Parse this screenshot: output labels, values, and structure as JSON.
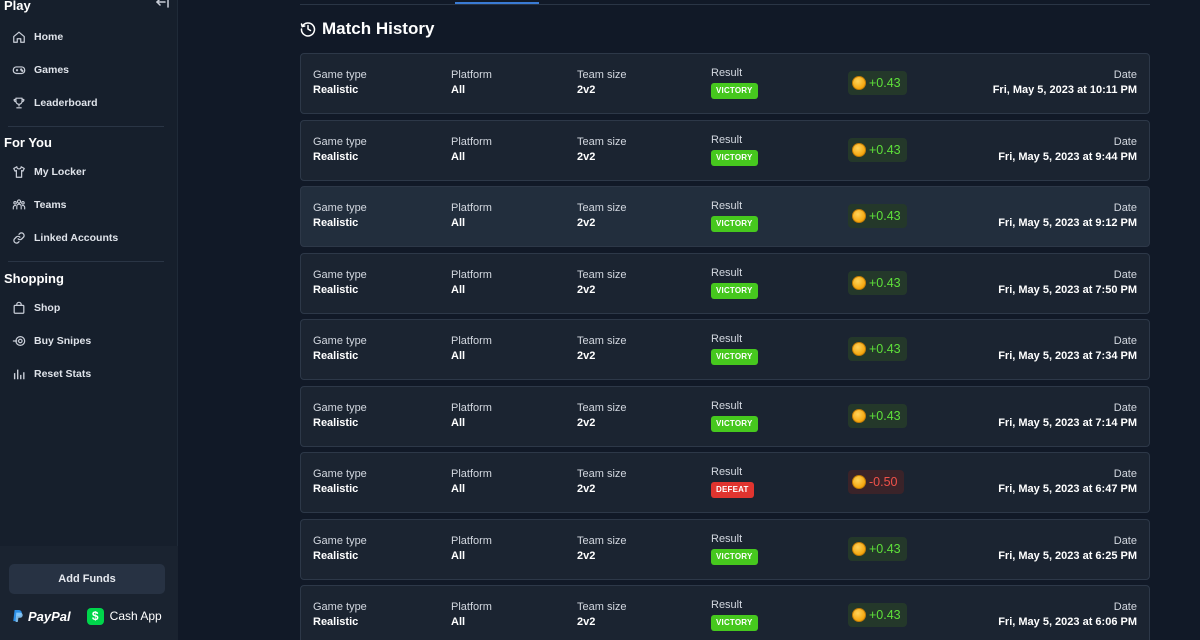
{
  "sidebar": {
    "sections": {
      "play": "Play",
      "for_you": "For You",
      "shopping": "Shopping"
    },
    "play_items": [
      {
        "label": "Home",
        "icon": "home-icon"
      },
      {
        "label": "Games",
        "icon": "gamepad-icon"
      },
      {
        "label": "Leaderboard",
        "icon": "trophy-icon"
      }
    ],
    "for_you_items": [
      {
        "label": "My Locker",
        "icon": "shirt-icon"
      },
      {
        "label": "Teams",
        "icon": "people-icon"
      },
      {
        "label": "Linked Accounts",
        "icon": "link-icon"
      }
    ],
    "shopping_items": [
      {
        "label": "Shop",
        "icon": "bag-icon"
      },
      {
        "label": "Buy Snipes",
        "icon": "target-icon"
      },
      {
        "label": "Reset Stats",
        "icon": "bar-chart-icon"
      }
    ],
    "add_funds_label": "Add Funds",
    "paypal_label": "PayPal",
    "cashapp_label": "Cash App",
    "cashapp_symbol": "$"
  },
  "main": {
    "title": "Match History",
    "labels": {
      "game_type": "Game type",
      "platform": "Platform",
      "team_size": "Team size",
      "result": "Result",
      "date": "Date"
    },
    "matches": [
      {
        "game_type": "Realistic",
        "platform": "All",
        "team_size": "2v2",
        "result": "VICTORY",
        "amount": "+0.43",
        "date": "Fri, May 5, 2023 at 10:11 PM"
      },
      {
        "game_type": "Realistic",
        "platform": "All",
        "team_size": "2v2",
        "result": "VICTORY",
        "amount": "+0.43",
        "date": "Fri, May 5, 2023 at 9:44 PM"
      },
      {
        "game_type": "Realistic",
        "platform": "All",
        "team_size": "2v2",
        "result": "VICTORY",
        "amount": "+0.43",
        "date": "Fri, May 5, 2023 at 9:12 PM"
      },
      {
        "game_type": "Realistic",
        "platform": "All",
        "team_size": "2v2",
        "result": "VICTORY",
        "amount": "+0.43",
        "date": "Fri, May 5, 2023 at 7:50 PM"
      },
      {
        "game_type": "Realistic",
        "platform": "All",
        "team_size": "2v2",
        "result": "VICTORY",
        "amount": "+0.43",
        "date": "Fri, May 5, 2023 at 7:34 PM"
      },
      {
        "game_type": "Realistic",
        "platform": "All",
        "team_size": "2v2",
        "result": "VICTORY",
        "amount": "+0.43",
        "date": "Fri, May 5, 2023 at 7:14 PM"
      },
      {
        "game_type": "Realistic",
        "platform": "All",
        "team_size": "2v2",
        "result": "DEFEAT",
        "amount": "-0.50",
        "date": "Fri, May 5, 2023 at 6:47 PM"
      },
      {
        "game_type": "Realistic",
        "platform": "All",
        "team_size": "2v2",
        "result": "VICTORY",
        "amount": "+0.43",
        "date": "Fri, May 5, 2023 at 6:25 PM"
      },
      {
        "game_type": "Realistic",
        "platform": "All",
        "team_size": "2v2",
        "result": "VICTORY",
        "amount": "+0.43",
        "date": "Fri, May 5, 2023 at 6:06 PM"
      }
    ]
  },
  "colors": {
    "victory": "#46c81e",
    "defeat": "#e0342f",
    "positive_text": "#5ee03a",
    "negative_text": "#f0524a",
    "cashapp": "#00d54b",
    "accent": "#3a7bd5"
  }
}
